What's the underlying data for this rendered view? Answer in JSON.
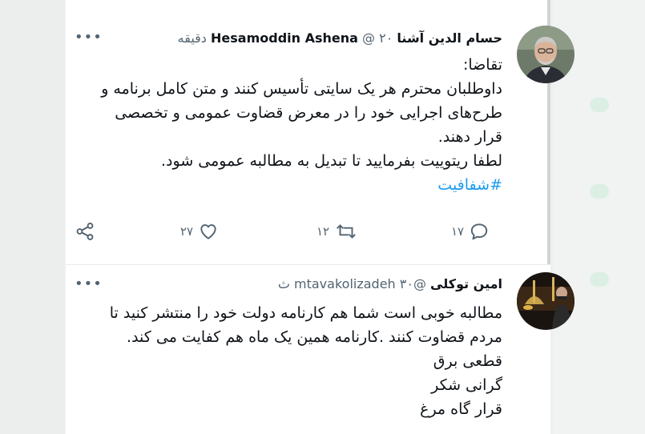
{
  "tweet1": {
    "name": "حسام الدین آشنا",
    "name_latin": "Hesamoddin Ashena",
    "handle": "@",
    "time": "۲۰ دقیقه",
    "more_label": "•••",
    "lines": [
      "تقاضا:",
      "داوطلبان محترم هر یک سایتی تأسیس کنند و متن کامل برنامه و",
      "طرح‌های اجرایی خود را در معرض قضاوت عمومی و تخصصی",
      "قرار دهند.",
      "لطفا ریتوییت بفرمایید تا تبدیل به مطالبه عمومی شود."
    ],
    "hashtag": "#شفافیت",
    "reply_count": "۱۷",
    "retweet_count": "۱۲",
    "like_count": "۲۷"
  },
  "tweet2": {
    "name": "امین توکلی",
    "handle": "@mtavakolizadeh",
    "time": "۳۰ ث",
    "more_label": "•••",
    "lines": [
      "مطالبه خوبی است شما هم کارنامه دولت خود را منتشر کنید تا",
      "مردم قضاوت کنند .کارنامه همین یک ماه هم کفایت می کند.",
      "قطعی برق",
      "گرانی شکر",
      "قرار گاه مرغ"
    ]
  },
  "icons": {
    "reply": "reply-icon",
    "retweet": "retweet-icon",
    "like": "heart-icon",
    "share": "share-icon",
    "more": "more-dots-icon"
  },
  "colors": {
    "text": "#0f1419",
    "secondary": "#536471",
    "hashtag": "#1d9bf0"
  }
}
